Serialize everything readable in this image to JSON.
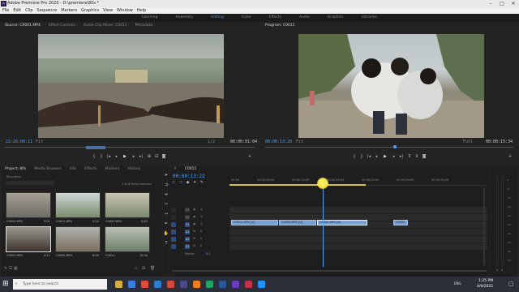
{
  "window": {
    "title": "Adobe Premiere Pro 2020 - D:\\premiere\\80s *",
    "logo": "Pr",
    "controls": [
      "–",
      "□",
      "✕"
    ]
  },
  "menu": [
    "File",
    "Edit",
    "Clip",
    "Sequence",
    "Markers",
    "Graphics",
    "View",
    "Window",
    "Help"
  ],
  "workspaces": [
    {
      "label": "Learning"
    },
    {
      "label": "Assembly"
    },
    {
      "label": "Editing",
      "active": true
    },
    {
      "label": "Color"
    },
    {
      "label": "Effects"
    },
    {
      "label": "Audio"
    },
    {
      "label": "Graphics"
    },
    {
      "label": "Libraries"
    }
  ],
  "source": {
    "tabs": [
      "Source: C0001.MP4",
      "Effect Controls",
      "Audio Clip Mixer: C0011",
      "Metadata"
    ],
    "timecode_left": "22:26:00:11",
    "fit": "Fit",
    "fraction": "1/2",
    "timecode_right": "00:00:01:04"
  },
  "program": {
    "tabs": [
      "Program: C0011"
    ],
    "timecode_left": "00:00:13:20",
    "fit": "Fit",
    "full": "Full",
    "timecode_right": "00:00:15:34"
  },
  "project": {
    "tabs": [
      "Project: 80s",
      "Media Browser",
      "Info",
      "Effects",
      "Markers",
      "History"
    ],
    "file": "80s.prproj",
    "items_info": "1 of 6 items selected",
    "items": [
      {
        "name": "C0002.MP4",
        "dur": "5:01",
        "c1": "#9a9184",
        "c2": "#6b6d65"
      },
      {
        "name": "C0011.MP4",
        "dur": "5:24",
        "c1": "#7a8c6a",
        "c2": "#cfd6d8"
      },
      {
        "name": "C0003.MP4",
        "dur": "4:40",
        "c1": "#b7b2a0",
        "c2": "#7b8a6e"
      },
      {
        "name": "C0001.MP4",
        "dur": "4:11",
        "c1": "#8c8a84",
        "c2": "#3d342c"
      },
      {
        "name": "C0005.MP4",
        "dur": "6:09",
        "c1": "#9c9f9a",
        "c2": "#7a6e5e"
      },
      {
        "name": "C0011",
        "dur": "15:34",
        "c1": "#6d7d66",
        "c2": "#b8c0b5"
      }
    ]
  },
  "timeline": {
    "tab": "C0011",
    "timecode": "00:00:13:22",
    "ruler": [
      "00:00",
      "00:00:05:00",
      "00:00:10:00",
      "00:00:15:00",
      "00:00:20:00",
      "00:00:25:00",
      "00:00:30:00"
    ],
    "video_tracks": [
      "V3",
      "V2",
      "V1"
    ],
    "audio_tracks": [
      "A1",
      "A2",
      "A3"
    ],
    "master": "Master",
    "master_val": "0.0",
    "clips": [
      "C0011.MP4 [V]",
      "C0003.MP4 [V]",
      "C0002.MP4 [V]",
      "C0005"
    ]
  },
  "meter": {
    "labels": [
      "0",
      "-6",
      "-12",
      "-18",
      "-24",
      "-30",
      "-36",
      "-42",
      "-48",
      "-54"
    ],
    "solo": [
      "S",
      "S"
    ]
  },
  "taskbar": {
    "search": "Type here to search",
    "time": "1:25 PM",
    "date": "4/9/2021",
    "lang": "ENG"
  },
  "colors": {
    "accent": "#3d9ae8",
    "clip": "#7a9fd1",
    "highlight": "#f5e64a"
  }
}
